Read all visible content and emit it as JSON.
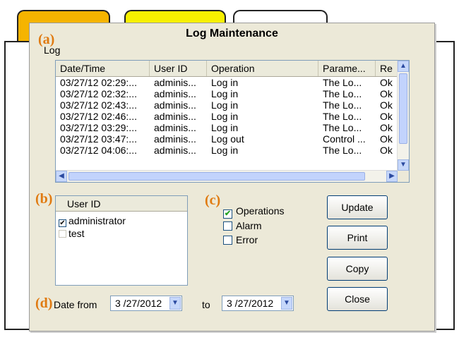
{
  "window": {
    "title": "Log Maintenance"
  },
  "markers": {
    "a": "(a)",
    "b": "(b)",
    "c": "(c)",
    "d": "(d)"
  },
  "log": {
    "group_label": "Log",
    "columns": [
      "Date/Time",
      "User ID",
      "Operation",
      "Parame...",
      "Re"
    ],
    "rows": [
      [
        "03/27/12 02:29:...",
        "adminis...",
        "Log in",
        "The Lo...",
        "Ok"
      ],
      [
        "03/27/12 02:32:...",
        "adminis...",
        "Log in",
        "The Lo...",
        "Ok"
      ],
      [
        "03/27/12 02:43:...",
        "adminis...",
        "Log in",
        "The Lo...",
        "Ok"
      ],
      [
        "03/27/12 02:46:...",
        "adminis...",
        "Log in",
        "The Lo...",
        "Ok"
      ],
      [
        "03/27/12 03:29:...",
        "adminis...",
        "Log in",
        "The Lo...",
        "Ok"
      ],
      [
        "03/27/12 03:47:...",
        "adminis...",
        "Log out",
        "Control ...",
        "Ok"
      ],
      [
        "03/27/12 04:06:...",
        "adminis...",
        "Log in",
        "The Lo...",
        "Ok"
      ]
    ]
  },
  "users": {
    "header": "User ID",
    "items": [
      {
        "label": "administrator",
        "checked": true
      },
      {
        "label": "test",
        "checked": false
      }
    ]
  },
  "filters": [
    {
      "label": "Operations",
      "checked": true
    },
    {
      "label": "Alarm",
      "checked": false
    },
    {
      "label": "Error",
      "checked": false
    }
  ],
  "buttons": {
    "update": "Update",
    "print": "Print",
    "copy": "Copy",
    "close": "Close"
  },
  "date": {
    "from_label": "Date from",
    "from_value": "3 /27/2012",
    "to_label": "to",
    "to_value": "3 /27/2012"
  },
  "colors": {
    "accent_marker": "#e07a10",
    "tab_orange": "#f5b400",
    "tab_yellow": "#f7f000",
    "check_green": "#21a121"
  },
  "icons": [
    "scroll-up-icon",
    "scroll-down-icon",
    "scroll-left-icon",
    "scroll-right-icon",
    "dropdown-arrow-icon",
    "checkmark-icon"
  ]
}
